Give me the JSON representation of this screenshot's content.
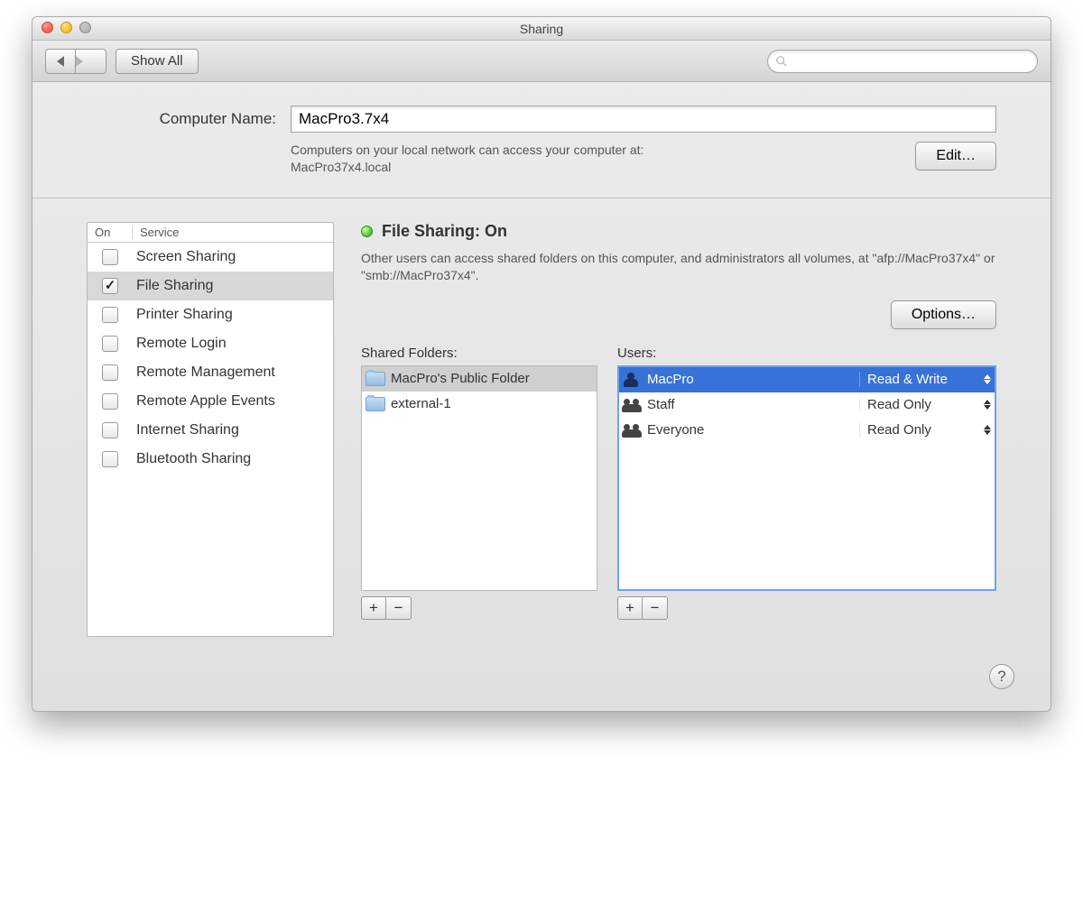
{
  "window": {
    "title": "Sharing"
  },
  "toolbar": {
    "show_all": "Show All",
    "search_placeholder": ""
  },
  "computer_name": {
    "label": "Computer Name:",
    "value": "MacPro3.7x4",
    "subtext_line1": "Computers on your local network can access your computer at:",
    "subtext_line2": "MacPro37x4.local",
    "edit_button": "Edit…"
  },
  "services": {
    "header_on": "On",
    "header_service": "Service",
    "items": [
      {
        "on": false,
        "name": "Screen Sharing"
      },
      {
        "on": true,
        "name": "File Sharing"
      },
      {
        "on": false,
        "name": "Printer Sharing"
      },
      {
        "on": false,
        "name": "Remote Login"
      },
      {
        "on": false,
        "name": "Remote Management"
      },
      {
        "on": false,
        "name": "Remote Apple Events"
      },
      {
        "on": false,
        "name": "Internet Sharing"
      },
      {
        "on": false,
        "name": "Bluetooth Sharing"
      }
    ],
    "selected_index": 1
  },
  "status": {
    "title": "File Sharing: On",
    "description": "Other users can access shared folders on this computer, and administrators all volumes, at \"afp://MacPro37x4\" or \"smb://MacPro37x4\".",
    "options_button": "Options…"
  },
  "shared_folders": {
    "label": "Shared Folders:",
    "items": [
      {
        "name": "MacPro's Public Folder"
      },
      {
        "name": "external-1"
      }
    ],
    "selected_index": 0
  },
  "users": {
    "label": "Users:",
    "items": [
      {
        "name": "MacPro",
        "icon": "person",
        "permission": "Read & Write"
      },
      {
        "name": "Staff",
        "icon": "group",
        "permission": "Read Only"
      },
      {
        "name": "Everyone",
        "icon": "group",
        "permission": "Read Only"
      }
    ],
    "selected_index": 0
  },
  "buttons": {
    "plus": "+",
    "minus": "−",
    "help": "?"
  }
}
